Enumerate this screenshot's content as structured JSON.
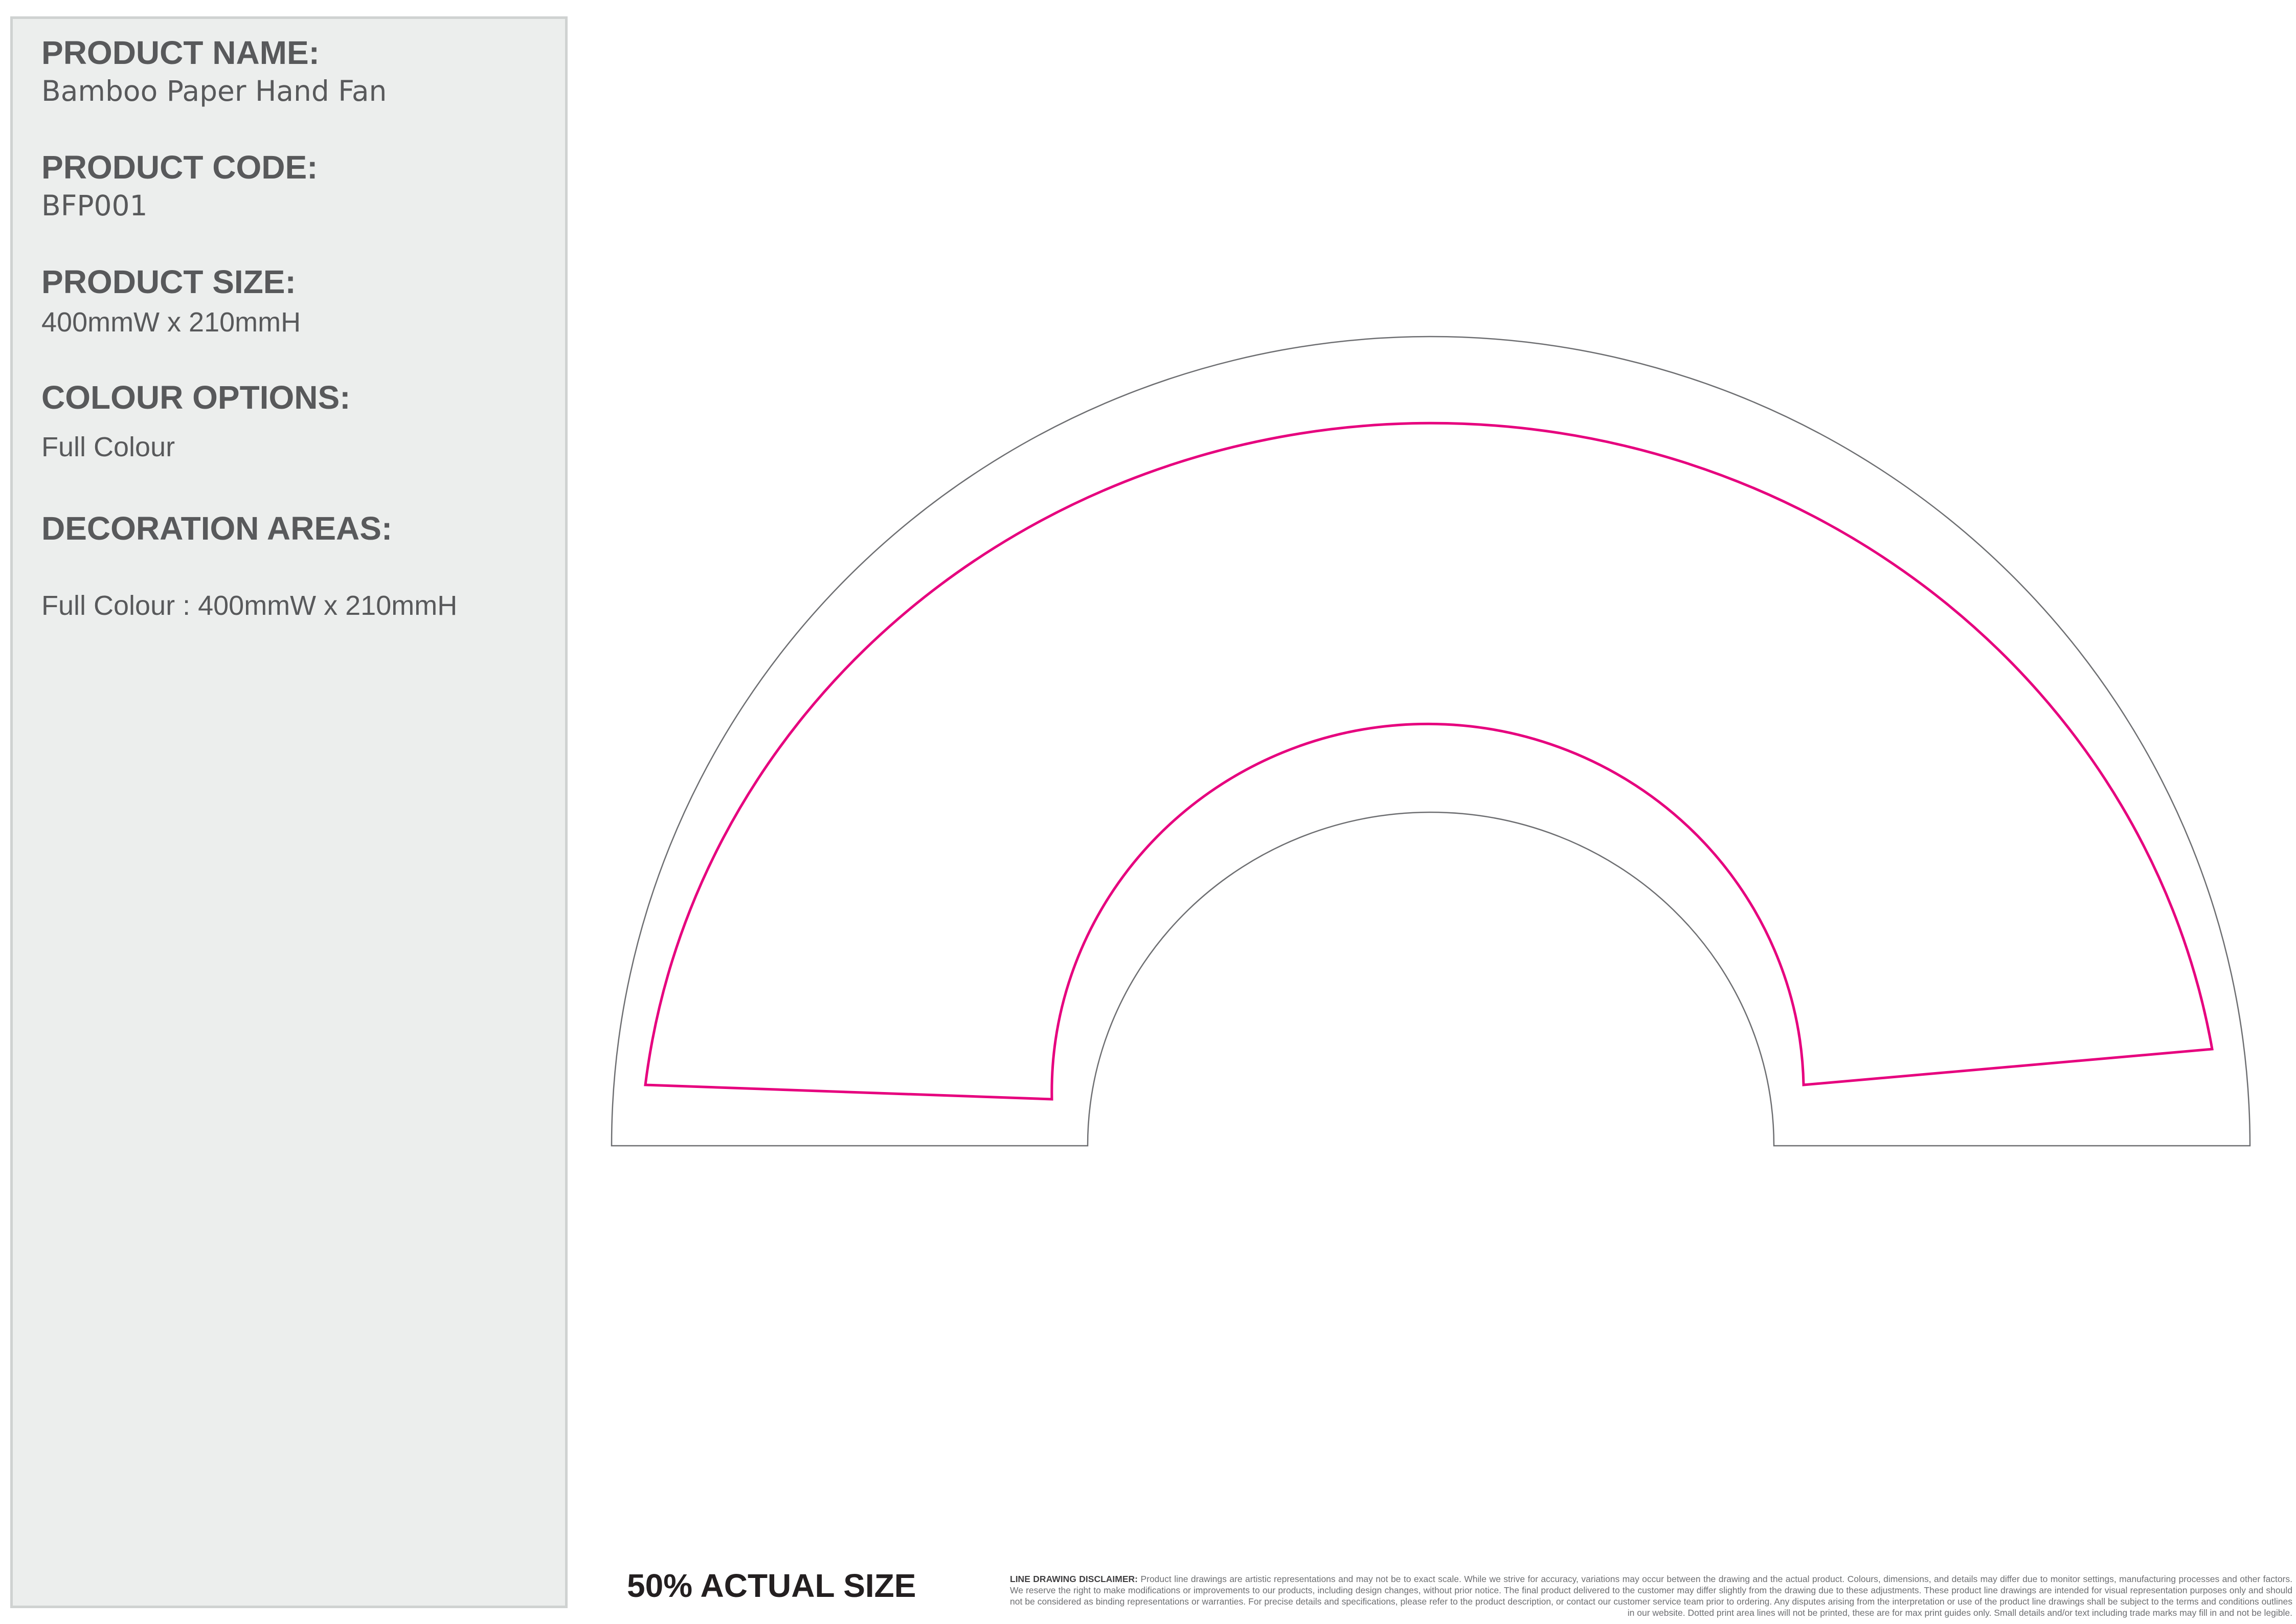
{
  "product": {
    "name_label": "PRODUCT NAME:",
    "name_value": "Bamboo Paper Hand Fan",
    "code_label": "PRODUCT CODE:",
    "code_value": "BFP001",
    "size_label": "PRODUCT SIZE:",
    "size_value": "400mmW x 210mmH",
    "colour_label": "COLOUR OPTIONS:",
    "colour_value": "Full Colour",
    "decoration_label": "DECORATION AREAS:",
    "decoration_value": "Full Colour : 400mmW x 210mmH"
  },
  "drawing": {
    "scale_label": "50% ACTUAL SIZE",
    "outline_color": "#6d6e71",
    "print_area_color": "#e6007e"
  },
  "disclaimer": {
    "title": "LINE DRAWING DISCLAIMER:",
    "text": "Product line drawings are artistic representations and may not be to exact scale. While we strive for accuracy, variations may occur between the drawing and the actual product. Colours, dimensions, and details may differ due to monitor settings, manufacturing processes and other factors. We reserve the right to make modifications or improvements to our products, including design changes, without prior notice. The final product delivered to the customer may differ slightly from the drawing due to these adjustments. These product line drawings are intended for visual representation purposes only and should not be considered as binding representations or warranties. For precise details and specifications, please refer to the product description, or contact our customer service team prior to ordering. Any disputes arising from the interpretation or use of the product line drawings shall be subject to the terms and conditions outlines in our website. Dotted print area lines will not be printed, these are for max print guides only. Small details and/or text including trade marks may fill in and not be legible."
  }
}
